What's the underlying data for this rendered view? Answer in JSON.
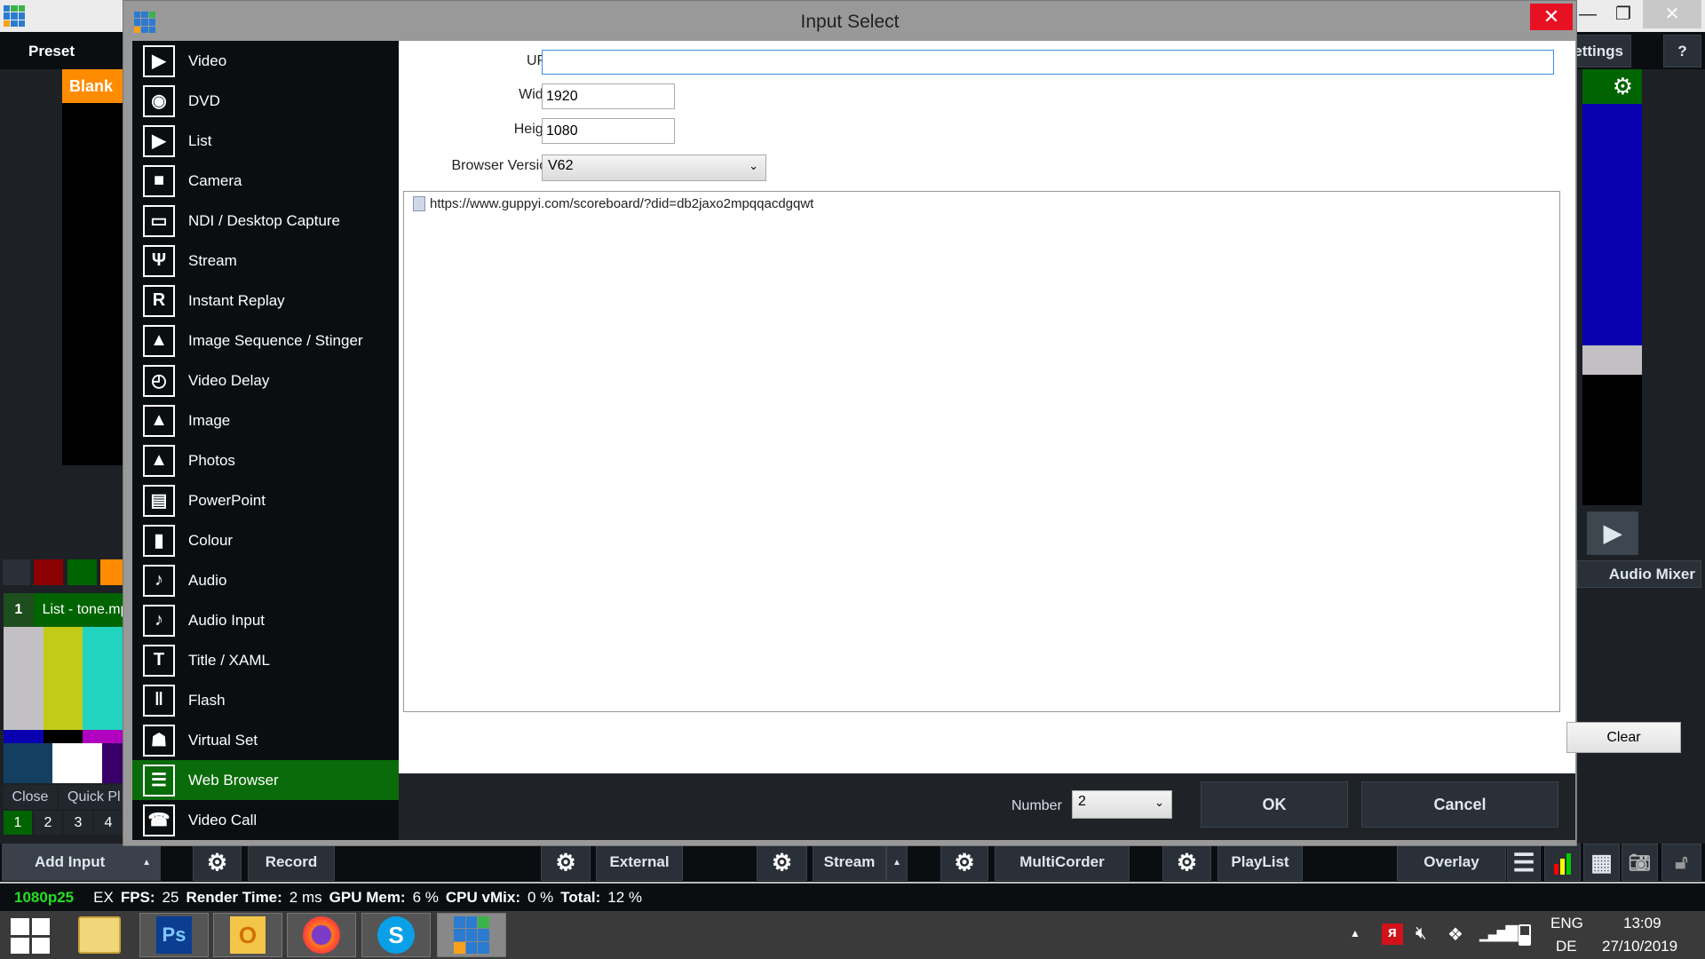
{
  "background": {
    "preset_label": "Preset",
    "blank_label": "Blank",
    "settings_label": "Settings",
    "help_label": "?",
    "input_number": "1",
    "input_name": "List - tone.mp",
    "close_label": "Close",
    "quick_play_label": "Quick Pl",
    "input_tabs": [
      "1",
      "2",
      "3",
      "4"
    ],
    "audio_mixer_label": "Audio Mixer",
    "colors": {
      "accent_orange": "#ff8c00",
      "green": "#006400",
      "blue": "#0a00b0",
      "red": "#8b0000"
    }
  },
  "dialog": {
    "title": "Input Select",
    "close_icon": "close-icon",
    "input_types": [
      {
        "label": "Video",
        "icon": "video-icon",
        "glyph": "▶"
      },
      {
        "label": "DVD",
        "icon": "disc-icon",
        "glyph": "◉"
      },
      {
        "label": "List",
        "icon": "list-icon",
        "glyph": "▶"
      },
      {
        "label": "Camera",
        "icon": "camera-icon",
        "glyph": "■"
      },
      {
        "label": "NDI / Desktop Capture",
        "icon": "monitor-icon",
        "glyph": "▭"
      },
      {
        "label": "Stream",
        "icon": "antenna-icon",
        "glyph": "Ψ"
      },
      {
        "label": "Instant Replay",
        "icon": "replay-icon",
        "glyph": "R"
      },
      {
        "label": "Image Sequence / Stinger",
        "icon": "image-sequence-icon",
        "glyph": "▲"
      },
      {
        "label": "Video Delay",
        "icon": "clock-icon",
        "glyph": "◴"
      },
      {
        "label": "Image",
        "icon": "image-icon",
        "glyph": "▲"
      },
      {
        "label": "Photos",
        "icon": "photos-icon",
        "glyph": "▲"
      },
      {
        "label": "PowerPoint",
        "icon": "presentation-icon",
        "glyph": "▤"
      },
      {
        "label": "Colour",
        "icon": "colour-icon",
        "glyph": "▮"
      },
      {
        "label": "Audio",
        "icon": "microphone-icon",
        "glyph": "♪"
      },
      {
        "label": "Audio Input",
        "icon": "microphone-icon",
        "glyph": "♪"
      },
      {
        "label": "Title / XAML",
        "icon": "title-icon",
        "glyph": "T"
      },
      {
        "label": "Flash",
        "icon": "flash-icon",
        "glyph": "‖"
      },
      {
        "label": "Virtual Set",
        "icon": "person-icon",
        "glyph": "☗"
      },
      {
        "label": "Web Browser",
        "icon": "browser-icon",
        "glyph": "☰",
        "selected": true
      },
      {
        "label": "Video Call",
        "icon": "video-call-icon",
        "glyph": "☎"
      }
    ],
    "form": {
      "url_label": "URL",
      "url_value": "",
      "width_label": "Width",
      "width_value": "1920",
      "height_label": "Height",
      "height_value": "1080",
      "browser_version_label": "Browser Version",
      "browser_version_value": "V62"
    },
    "history": [
      "https://www.guppyi.com/scoreboard/?did=db2jaxo2mpqqacdgqwt"
    ],
    "clear_label": "Clear",
    "number_label": "Number",
    "number_value": "2",
    "ok_label": "OK",
    "cancel_label": "Cancel"
  },
  "toolbar": {
    "add_input": "Add Input",
    "record": "Record",
    "external": "External",
    "stream": "Stream",
    "multicorder": "MultiCorder",
    "playlist": "PlayList",
    "overlay": "Overlay"
  },
  "status": {
    "format": "1080p25",
    "ex": "EX",
    "fps_label": "FPS:",
    "fps": "25",
    "render_label": "Render Time:",
    "render": "2 ms",
    "gpu_label": "GPU Mem:",
    "gpu": "6 %",
    "cpu_label": "CPU vMix:",
    "cpu": "0 %",
    "total_label": "Total:",
    "total": "12 %"
  },
  "taskbar": {
    "apps": [
      "Windows Start",
      "File Explorer",
      "Photoshop",
      "Outlook",
      "Firefox",
      "Skype",
      "vMix"
    ],
    "ps_label": "Ps",
    "skype_label": "S",
    "lang1": "ENG",
    "lang2": "DE",
    "time": "13:09",
    "date": "27/10/2019"
  }
}
